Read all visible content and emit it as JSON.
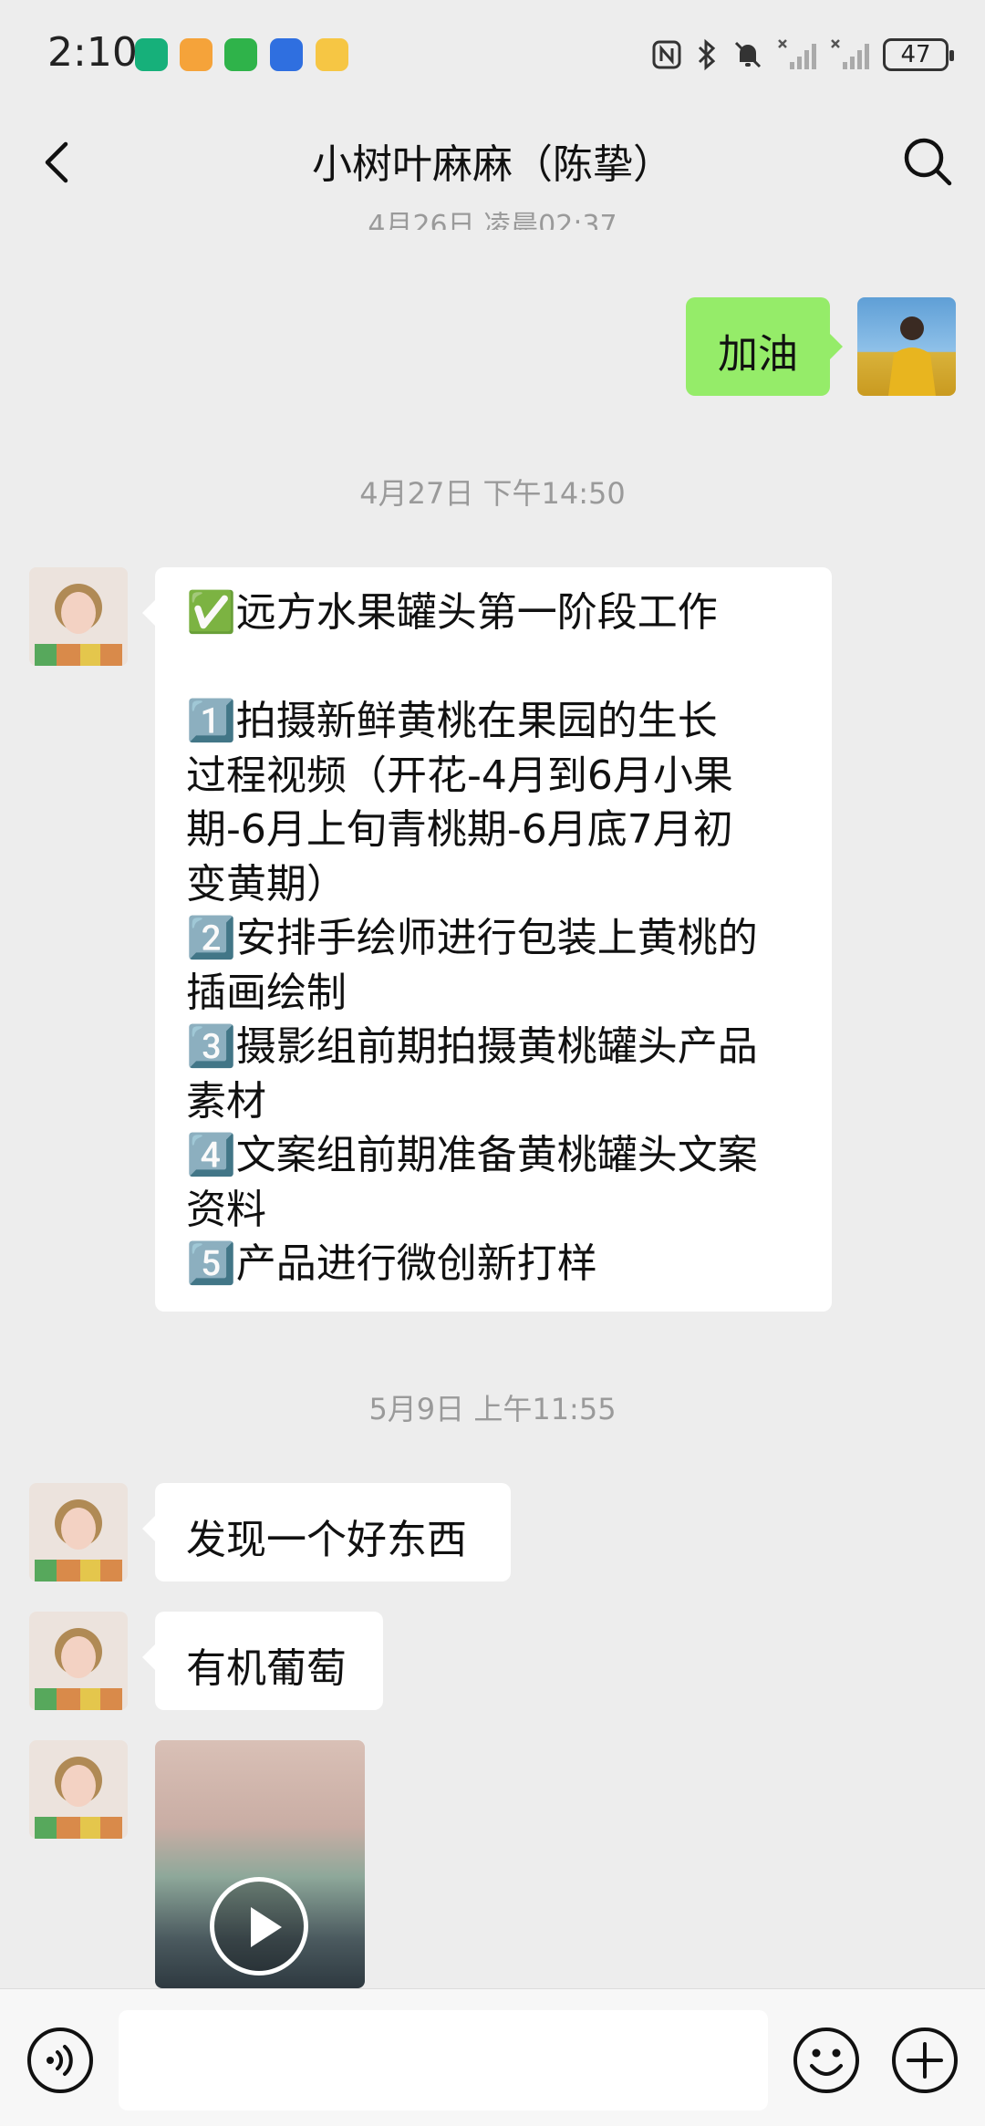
{
  "status_bar": {
    "time": "2:10",
    "battery": "47"
  },
  "header": {
    "title": "小树叶麻麻（陈挚）"
  },
  "messages": {
    "cut_timestamp": "4月26日 凌晨02:37",
    "msg1_text": "加油",
    "timestamp_1": "4月27日 下午14:50",
    "msg2_text": "✅远方水果罐头第一阶段工作\n\n1️⃣拍摄新鲜黄桃在果园的生长\n过程视频（开花-4月到6月小果\n期-6月上旬青桃期-6月底7月初\n变黄期）\n2️⃣安排手绘师进行包装上黄桃的\n插画绘制\n3️⃣摄影组前期拍摄黄桃罐头产品\n素材\n4️⃣文案组前期准备黄桃罐头文案\n资料\n5️⃣产品进行微创新打样",
    "timestamp_2": "5月9日 上午11:55",
    "msg3_text": "发现一个好东西",
    "msg4_text": "有机葡萄"
  },
  "input_bar": {
    "placeholder": ""
  },
  "colors": {
    "background": "#ededed",
    "outgoing_bubble": "#95ec69",
    "incoming_bubble": "#ffffff",
    "timestamp_text": "#9a9a9a"
  }
}
